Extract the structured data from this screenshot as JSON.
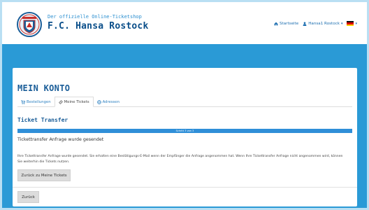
{
  "colors": {
    "page_background": "#2a9ad6",
    "header_background": "#ffffff",
    "brand_blue": "#1a5d98",
    "link_blue": "#2a7fc0",
    "progress_fill": "#2f8fd8"
  },
  "header": {
    "subtitle": "Der offizielle Online-Ticketshop",
    "title": "F.C. Hansa Rostock",
    "logo_icon": "hansa-rostock-crest",
    "nav": {
      "home_label": "Startseite",
      "home_icon": "home-icon",
      "user_label": "Hansa1 Rostock",
      "user_icon": "user-icon",
      "language_flag": "german-flag"
    }
  },
  "main": {
    "page_title": "MEIN KONTO",
    "tabs": [
      {
        "label": "Bestellungen",
        "icon": "cart-icon",
        "active": false
      },
      {
        "label": "Meine Tickets",
        "icon": "ticket-icon",
        "active": true
      },
      {
        "label": "Adressen",
        "icon": "globe-icon",
        "active": false
      }
    ],
    "section_title": "Ticket Transfer",
    "progress": {
      "label": "Schritt 3 von 3",
      "percent": 100
    },
    "status_text": "Tickettransfer Anfrage wurde gesendet",
    "description": "Ihre Tickettransfer Anfrage wurde gesendet. Sie erhalten eine Bestätigungs-E-Mail wenn der Empfänger die Anfrage angenommen hat. Wenn Ihre Tickettransfer Anfrage nicht angenommen wird, können Sie weiterhin die Tickets nutzen.",
    "back_to_tickets_label": "Zurück zu Meine Tickets",
    "back_label": "Zurück"
  }
}
